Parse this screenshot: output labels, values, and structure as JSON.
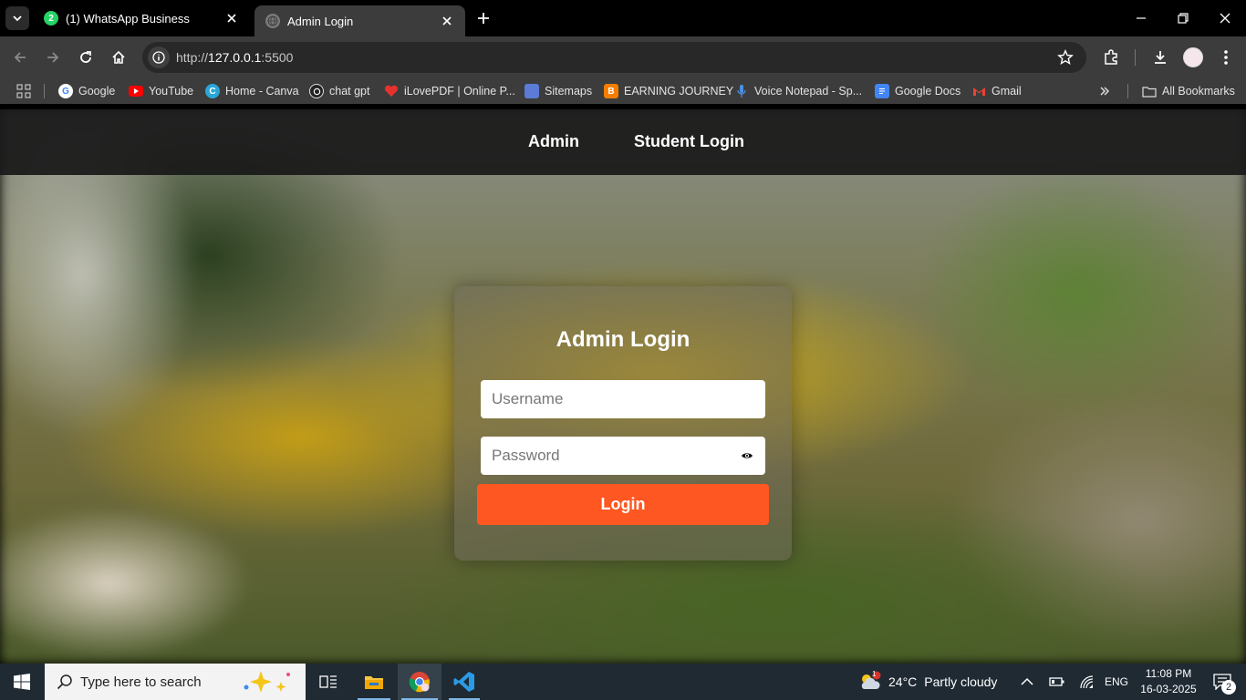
{
  "browser": {
    "tabs": [
      {
        "title": "(1) WhatsApp Business",
        "badge": "2",
        "active": false
      },
      {
        "title": "Admin Login",
        "active": true
      }
    ],
    "url": {
      "prefix": "http://",
      "host": "127.0.0.1",
      "port": ":5500"
    },
    "bookmarks": [
      {
        "label": "Google",
        "icon": "google-icon"
      },
      {
        "label": "YouTube",
        "icon": "youtube-icon"
      },
      {
        "label": "Home - Canva",
        "icon": "canva-icon"
      },
      {
        "label": "chat gpt",
        "icon": "chatgpt-icon"
      },
      {
        "label": "iLovePDF | Online P...",
        "icon": "ilovepdf-icon"
      },
      {
        "label": "Sitemaps",
        "icon": "sitemaps-icon"
      },
      {
        "label": "EARNING JOURNEY",
        "icon": "blogger-icon"
      },
      {
        "label": "Voice Notepad - Sp...",
        "icon": "microphone-icon"
      },
      {
        "label": "Google Docs",
        "icon": "docs-icon"
      },
      {
        "label": "Gmail",
        "icon": "gmail-icon"
      }
    ],
    "all_bookmarks": "All Bookmarks"
  },
  "page": {
    "nav": {
      "admin": "Admin",
      "student": "Student Login"
    },
    "login": {
      "title": "Admin Login",
      "username_placeholder": "Username",
      "password_placeholder": "Password",
      "button": "Login"
    },
    "colors": {
      "accent": "#ff5722",
      "navbar": "#191919"
    }
  },
  "taskbar": {
    "search_placeholder": "Type here to search",
    "weather": {
      "temp": "24°C",
      "condition": "Partly cloudy",
      "alert": "1"
    },
    "language": "ENG",
    "time": "11:08 PM",
    "date": "16-03-2025",
    "notifications": "2"
  }
}
